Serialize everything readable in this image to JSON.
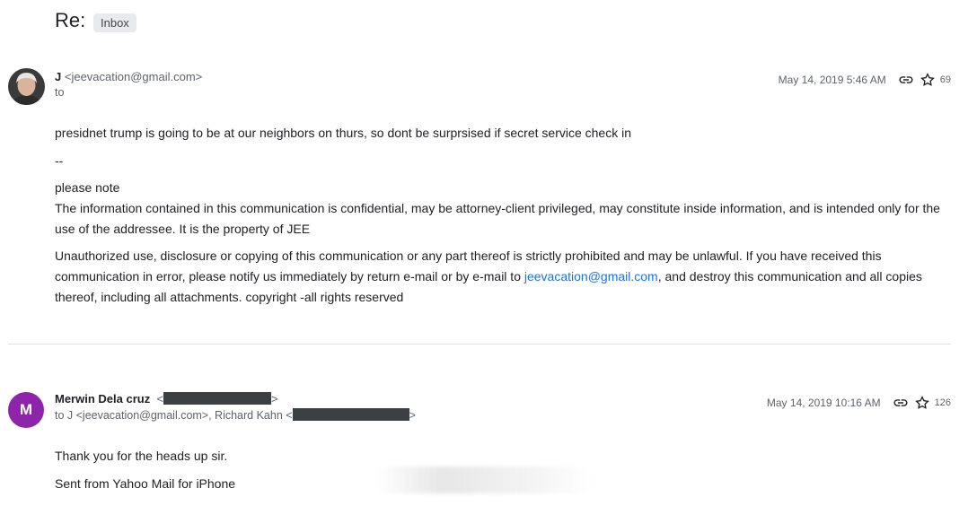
{
  "thread": {
    "subject": "Re:",
    "label": "Inbox"
  },
  "messages": [
    {
      "sender_name": "J",
      "sender_email": "<jeevacation@gmail.com>",
      "to_line": "to",
      "date": "May 14, 2019 5:46 AM",
      "count": "69",
      "body": {
        "line1": "presidnet trump is going to be at our neighbors on thurs, so dont be surprsised if secret service check in",
        "sig_sep": "--",
        "please_note": "please note",
        "para1": "The information contained in this communication is confidential, may be attorney-client privileged, may constitute inside information, and is intended only for the use of the addressee. It is the property of JEE",
        "para2_before": "Unauthorized use, disclosure or copying of this communication or any part thereof is strictly prohibited and may be unlawful. If you have received this communication in error, please notify us immediately by return e-mail or by e-mail to ",
        "para2_link": "jeevacation@gmail.com",
        "para2_after": ", and destroy this communication and all copies thereof, including all attachments. copyright -all rights reserved"
      }
    },
    {
      "avatar_letter": "M",
      "sender_name": "Merwin Dela cruz",
      "email_open": "<",
      "email_close": ">",
      "to_prefix": "to J <jeevacation@gmail.com>, Richard Kahn <",
      "to_suffix": ">",
      "date": "May 14, 2019 10:16 AM",
      "count": "126",
      "body": {
        "line1": "Thank you for the heads up sir.",
        "line2": "Sent from Yahoo Mail for iPhone"
      }
    }
  ],
  "colors": {
    "avatar_purple": "#8e24aa",
    "link_blue": "#1a73e8"
  },
  "icons": {
    "link": "link-icon",
    "star": "star-icon"
  }
}
